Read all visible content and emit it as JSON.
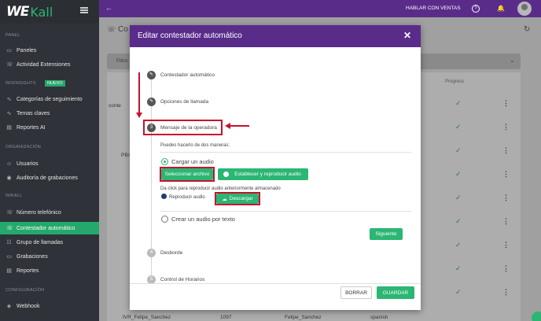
{
  "app": {
    "logo_part1": "WE",
    "logo_part2": "Kall"
  },
  "topbar": {
    "back_icon": "←",
    "cta": "HABLAR CON VENTAS",
    "help_icon": "?",
    "bell_icon": "🔔"
  },
  "sidebar": {
    "sections": {
      "panel": "PANEL",
      "wisinsights": "WISINSIGHTS",
      "org": "ORGANIZACIÓN",
      "wikall": "WIKALL",
      "config": "CONFIGURACIÓN"
    },
    "badge_new": "NUEVO",
    "items": [
      {
        "label": "Paneles",
        "icon": "▭"
      },
      {
        "label": "Actividad Extensiones",
        "icon": "☏"
      },
      {
        "label": "Categorías de seguimiento",
        "icon": "∿"
      },
      {
        "label": "Temas claves",
        "icon": "∿"
      },
      {
        "label": "Reportes AI",
        "icon": "▤"
      },
      {
        "label": "Usuarios",
        "icon": "☺"
      },
      {
        "label": "Auditoría de grabaciones",
        "icon": "◉"
      },
      {
        "label": "Número telefónico",
        "icon": "☏"
      },
      {
        "label": "Contestador automático",
        "icon": "☏"
      },
      {
        "label": "Grupo de llamadas",
        "icon": "☷"
      },
      {
        "label": "Grabaciones",
        "icon": "▭"
      },
      {
        "label": "Reportes",
        "icon": "▤"
      },
      {
        "label": "Webhook",
        "icon": "◈"
      }
    ]
  },
  "page": {
    "title_fragment": "Co",
    "filter_fragment": "Filtro",
    "table": {
      "header_progress": "Progress",
      "row_fragments": {
        "cont": "conte",
        "pb": "PBX"
      },
      "last_row": [
        "IVR_Felipe_Sanchez",
        "1097",
        "Felipe_Sanchez",
        "spanish"
      ],
      "check_icon": "✓",
      "menu_icon": "⋮"
    }
  },
  "modal": {
    "title": "Editar contestador automático",
    "close": "✕",
    "steps": [
      {
        "label": "Contestador automático",
        "icon": "✎"
      },
      {
        "label": "Opciones de llamada",
        "icon": "✎"
      },
      {
        "label": "Mensaje de la operadora",
        "icon": "3"
      },
      {
        "label": "Desborde",
        "icon": "4"
      },
      {
        "label": "Control de Horarios",
        "icon": "5"
      }
    ],
    "intro": "Puedes hacerlo de dos maneras:",
    "option_upload": "Cargar un audio",
    "btn_select": "Seleccionar archivo",
    "btn_establish": "Establecer y reproducir audio",
    "hint_play": "Da click para reproducir audio anteriormente almacenado",
    "play_label": "Reproducir audio",
    "btn_download": "Descargar",
    "option_text": "Crear un audio por texto",
    "btn_next": "Siguiente",
    "btn_clear": "BORRAR",
    "btn_save": "GUARDAR"
  },
  "colors": {
    "purple": "#5a2c8a",
    "green": "#2bb673",
    "sidebar": "#2f3238",
    "annotation_red": "#c8102e"
  }
}
